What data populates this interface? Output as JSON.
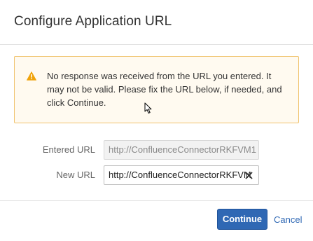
{
  "dialog": {
    "title": "Configure Application URL"
  },
  "warning": {
    "icon": "warning-icon",
    "icon_color": "#f0a30a",
    "message": "No response was received from the URL you entered. It may not be valid. Please fix the URL below, if needed, and click Continue."
  },
  "form": {
    "entered_url": {
      "label": "Entered URL",
      "value": "http://ConfluenceConnectorRKFVM1"
    },
    "new_url": {
      "label": "New URL",
      "value": "http://ConfluenceConnectorRKFVM",
      "clear_icon": "close-icon"
    }
  },
  "footer": {
    "continue_label": "Continue",
    "cancel_label": "Cancel"
  },
  "colors": {
    "primary": "#2f68b4",
    "warning_border": "#f0c36d",
    "warning_background": "#fffaf0"
  }
}
